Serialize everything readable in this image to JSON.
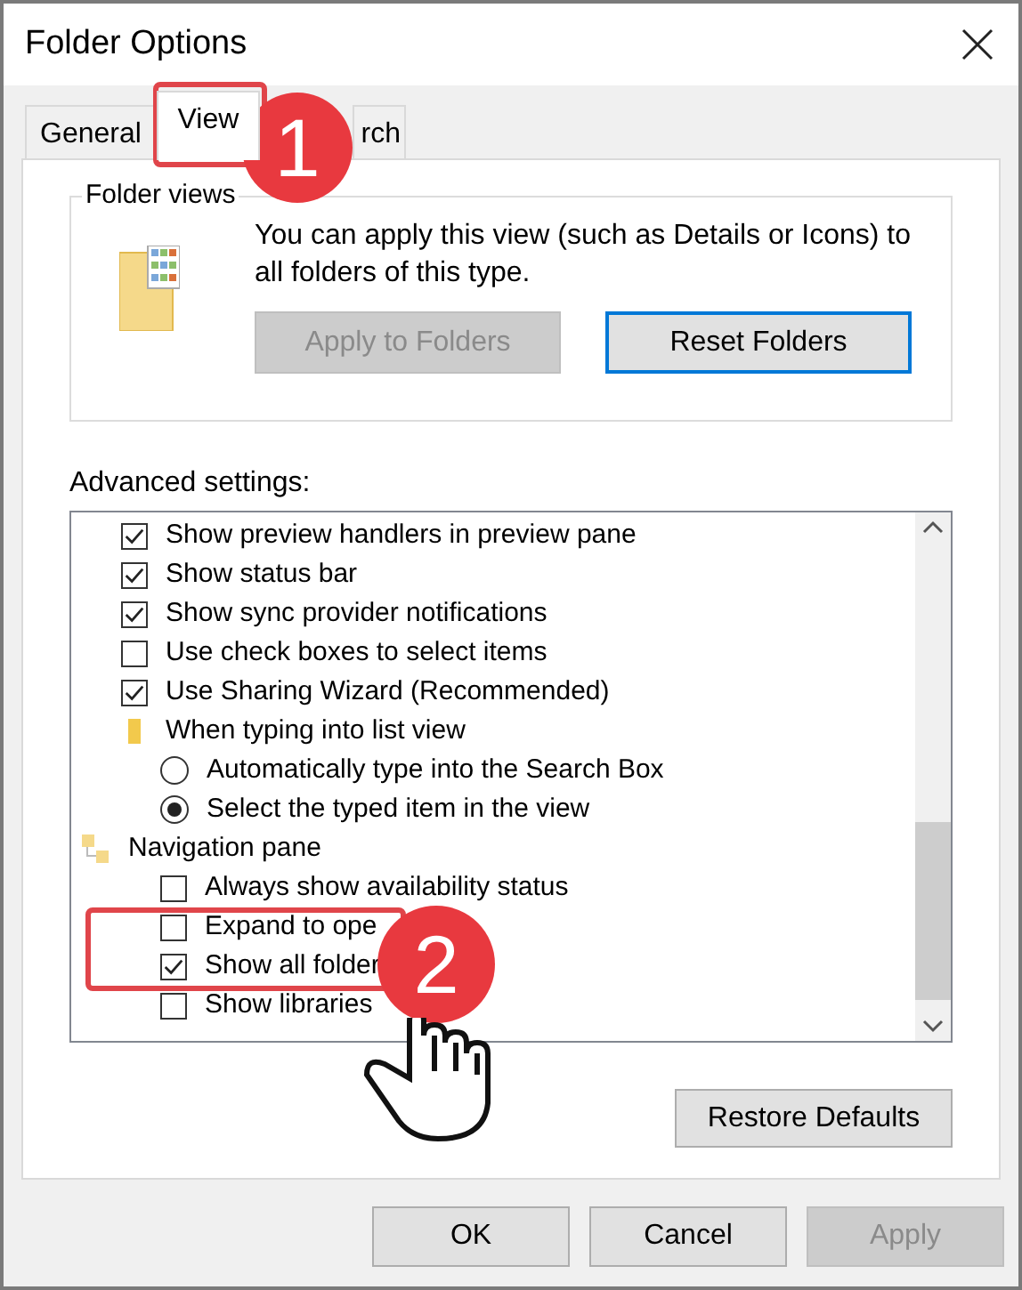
{
  "window": {
    "title": "Folder Options"
  },
  "tabs": [
    {
      "label": "General",
      "selected": false
    },
    {
      "label": "View",
      "selected": true
    },
    {
      "label": "rch",
      "selected": false
    }
  ],
  "folder_views": {
    "title": "Folder views",
    "description": "You can apply this view (such as Details or Icons) to all folders of this type.",
    "buttons": [
      {
        "label": "Apply to Folders",
        "disabled": true,
        "default": false
      },
      {
        "label": "Reset Folders",
        "disabled": false,
        "default": true
      }
    ]
  },
  "advanced_settings": {
    "label": "Advanced settings:",
    "items": [
      {
        "kind": "checkbox",
        "label": "Show preview handlers in preview pane",
        "checked": true
      },
      {
        "kind": "checkbox",
        "label": "Show status bar",
        "checked": true
      },
      {
        "kind": "checkbox",
        "label": "Show sync provider notifications",
        "checked": true
      },
      {
        "kind": "checkbox",
        "label": "Use check boxes to select items",
        "checked": false
      },
      {
        "kind": "checkbox",
        "label": "Use Sharing Wizard (Recommended)",
        "checked": true
      },
      {
        "kind": "group",
        "label": "When typing into list view",
        "children": [
          {
            "kind": "radio",
            "label": "Automatically type into the Search Box",
            "selected": false
          },
          {
            "kind": "radio",
            "label": "Select the typed item in the view",
            "selected": true
          }
        ]
      },
      {
        "kind": "category",
        "label": "Navigation pane",
        "children": [
          {
            "kind": "checkbox",
            "label": "Always show availability status",
            "checked": false
          },
          {
            "kind": "checkbox",
            "label": "Expand to ope",
            "checked": false
          },
          {
            "kind": "checkbox",
            "label": "Show all folder",
            "checked": true
          },
          {
            "kind": "checkbox",
            "label": "Show libraries",
            "checked": false
          }
        ]
      }
    ]
  },
  "restore_button": {
    "label": "Restore Defaults"
  },
  "buttons": [
    {
      "label": "OK",
      "disabled": false
    },
    {
      "label": "Cancel",
      "disabled": false
    },
    {
      "label": "Apply",
      "disabled": true
    }
  ],
  "annotations": [
    {
      "number": "1"
    },
    {
      "number": "2"
    }
  ]
}
